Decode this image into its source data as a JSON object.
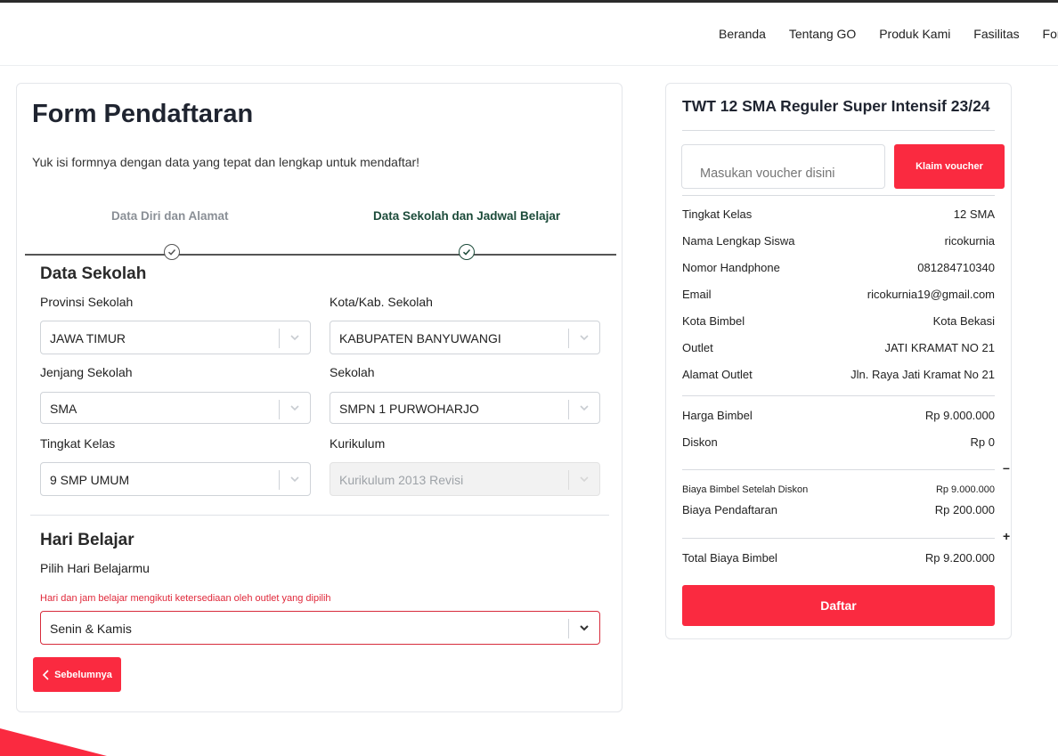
{
  "nav": {
    "items": [
      "Beranda",
      "Tentang GO",
      "Produk Kami",
      "Fasilitas",
      "Formulir"
    ]
  },
  "form": {
    "title": "Form Pendaftaran",
    "subtitle": "Yuk isi formnya dengan data yang tepat dan lengkap untuk mendaftar!",
    "steps": [
      {
        "label": "Data Diri dan Alamat",
        "state": "done"
      },
      {
        "label": "Data Sekolah dan Jadwal Belajar",
        "state": "active"
      }
    ],
    "school_section": {
      "title": "Data Sekolah",
      "fields": [
        {
          "label": "Provinsi Sekolah",
          "value": "JAWA TIMUR"
        },
        {
          "label": "Kota/Kab. Sekolah",
          "value": "KABUPATEN BANYUWANGI"
        },
        {
          "label": "Jenjang Sekolah",
          "value": "SMA"
        },
        {
          "label": "Sekolah",
          "value": "SMPN 1 PURWOHARJO"
        },
        {
          "label": "Tingkat Kelas",
          "value": "9 SMP UMUM"
        },
        {
          "label": "Kurikulum",
          "value": "Kurikulum 2013 Revisi",
          "disabled": true
        }
      ]
    },
    "day_section": {
      "title": "Hari Belajar",
      "label": "Pilih Hari Belajarmu",
      "hint": "Hari dan jam belajar mengikuti ketersediaan oleh outlet yang dipilih",
      "value": "Senin & Kamis"
    },
    "prev_button": "Sebelumnya"
  },
  "summary": {
    "title": "TWT 12 SMA Reguler Super Intensif 23/24",
    "voucher_placeholder": "Masukan voucher disini",
    "claim_button": "Klaim voucher",
    "details": [
      {
        "label": "Tingkat Kelas",
        "value": "12 SMA"
      },
      {
        "label": "Nama Lengkap Siswa",
        "value": "ricokurnia"
      },
      {
        "label": "Nomor Handphone",
        "value": "081284710340"
      },
      {
        "label": "Email",
        "value": "ricokurnia19@gmail.com"
      },
      {
        "label": "Kota Bimbel",
        "value": "Kota Bekasi"
      },
      {
        "label": "Outlet",
        "value": "JATI KRAMAT NO 21"
      },
      {
        "label": "Alamat Outlet",
        "value": "Jln. Raya Jati Kramat No 21"
      }
    ],
    "price": {
      "label": "Harga Bimbel",
      "value": "Rp 9.000.000"
    },
    "discount": {
      "label": "Diskon",
      "value": "Rp 0"
    },
    "minus_sign": "–",
    "after_discount": {
      "label": "Biaya Bimbel Setelah Diskon",
      "value": "Rp 9.000.000"
    },
    "registration": {
      "label": "Biaya Pendaftaran",
      "value": "Rp 200.000"
    },
    "plus_sign": "+",
    "total": {
      "label": "Total Biaya Bimbel",
      "value": "Rp 9.200.000"
    },
    "submit_button": "Daftar"
  },
  "colors": {
    "accent": "#fa2a40",
    "step_active": "#1c4b3a",
    "step_inactive": "#8a8f96"
  }
}
